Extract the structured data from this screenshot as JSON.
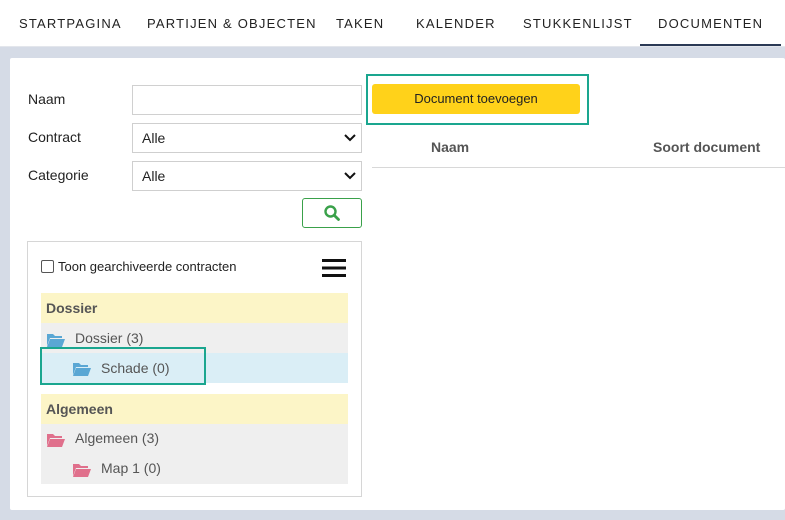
{
  "nav": {
    "tabs": [
      {
        "label": "STARTPAGINA"
      },
      {
        "label": "PARTIJEN & OBJECTEN"
      },
      {
        "label": "TAKEN"
      },
      {
        "label": "KALENDER"
      },
      {
        "label": "STUKKENLIJST"
      },
      {
        "label": "DOCUMENTEN",
        "active": true
      }
    ]
  },
  "filters": {
    "naam_label": "Naam",
    "naam_value": "",
    "contract_label": "Contract",
    "contract_value": "Alle",
    "categorie_label": "Categorie",
    "categorie_value": "Alle",
    "search_icon": "search-icon"
  },
  "tree": {
    "archived_label": "Toon gearchiveerde contracten",
    "archived_checked": false,
    "menu_icon": "hamburger-menu-icon",
    "groups": [
      {
        "header": "Dossier",
        "folder_color": "#5aa7d4",
        "items": [
          {
            "label": "Dossier (3)"
          },
          {
            "label": "Schade (0)",
            "selected": true
          }
        ]
      },
      {
        "header": "Algemeen",
        "folder_color": "#e0708c",
        "items": [
          {
            "label": "Algemeen (3)"
          },
          {
            "label": "Map 1 (0)"
          }
        ]
      }
    ]
  },
  "documents": {
    "add_button": "Document toevoegen",
    "columns": [
      "Naam",
      "Soort document"
    ]
  },
  "colors": {
    "highlight": "#1aa68f",
    "add_button": "#ffd21a",
    "search_button_border": "#3aa14a"
  }
}
